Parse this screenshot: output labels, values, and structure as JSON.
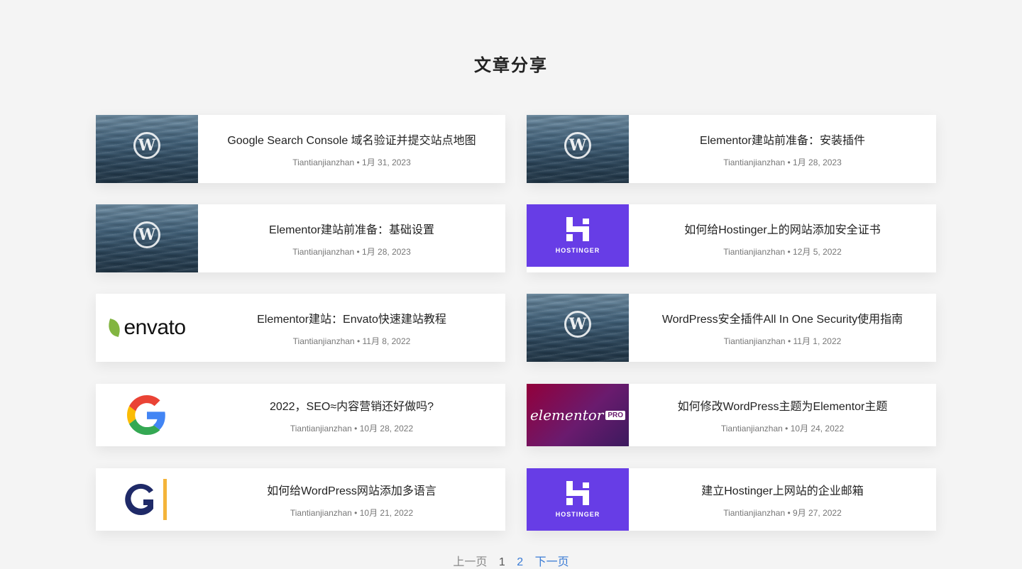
{
  "page": {
    "title": "文章分享"
  },
  "posts": [
    {
      "title": "Google Search Console 域名验证并提交站点地图",
      "author": "Tiantianjianzhan",
      "date": "1月 31, 2023",
      "thumb": "wordpress-water"
    },
    {
      "title": "Elementor建站前准备：安装插件",
      "author": "Tiantianjianzhan",
      "date": "1月 28, 2023",
      "thumb": "wordpress-water"
    },
    {
      "title": "Elementor建站前准备：基础设置",
      "author": "Tiantianjianzhan",
      "date": "1月 28, 2023",
      "thumb": "wordpress-water"
    },
    {
      "title": "如何给Hostinger上的网站添加安全证书",
      "author": "Tiantianjianzhan",
      "date": "12月 5, 2022",
      "thumb": "hostinger",
      "thumb_label": "HOSTINGER"
    },
    {
      "title": "Elementor建站：Envato快速建站教程",
      "author": "Tiantianjianzhan",
      "date": "11月 8, 2022",
      "thumb": "envato",
      "thumb_label": "envato"
    },
    {
      "title": "WordPress安全插件All In One Security使用指南",
      "author": "Tiantianjianzhan",
      "date": "11月 1, 2022",
      "thumb": "wordpress-water"
    },
    {
      "title": "2022，SEO≈内容营销还好做吗?",
      "author": "Tiantianjianzhan",
      "date": "10月 28, 2022",
      "thumb": "google"
    },
    {
      "title": "如何修改WordPress主题为Elementor主题",
      "author": "Tiantianjianzhan",
      "date": "10月 24, 2022",
      "thumb": "elementor-pro",
      "thumb_label": "elementor",
      "thumb_badge": "PRO"
    },
    {
      "title": "如何给WordPress网站添加多语言",
      "author": "Tiantianjianzhan",
      "date": "10月 21, 2022",
      "thumb": "gtranslate"
    },
    {
      "title": "建立Hostinger上网站的企业邮箱",
      "author": "Tiantianjianzhan",
      "date": "9月 27, 2022",
      "thumb": "hostinger",
      "thumb_label": "HOSTINGER"
    }
  ],
  "meta_separator": "•",
  "pagination": {
    "prev": "上一页",
    "pages": [
      "1",
      "2"
    ],
    "next": "下一页"
  },
  "colors": {
    "background": "#f4f4f4",
    "hostinger": "#673de6",
    "link": "#3a7bd5"
  }
}
